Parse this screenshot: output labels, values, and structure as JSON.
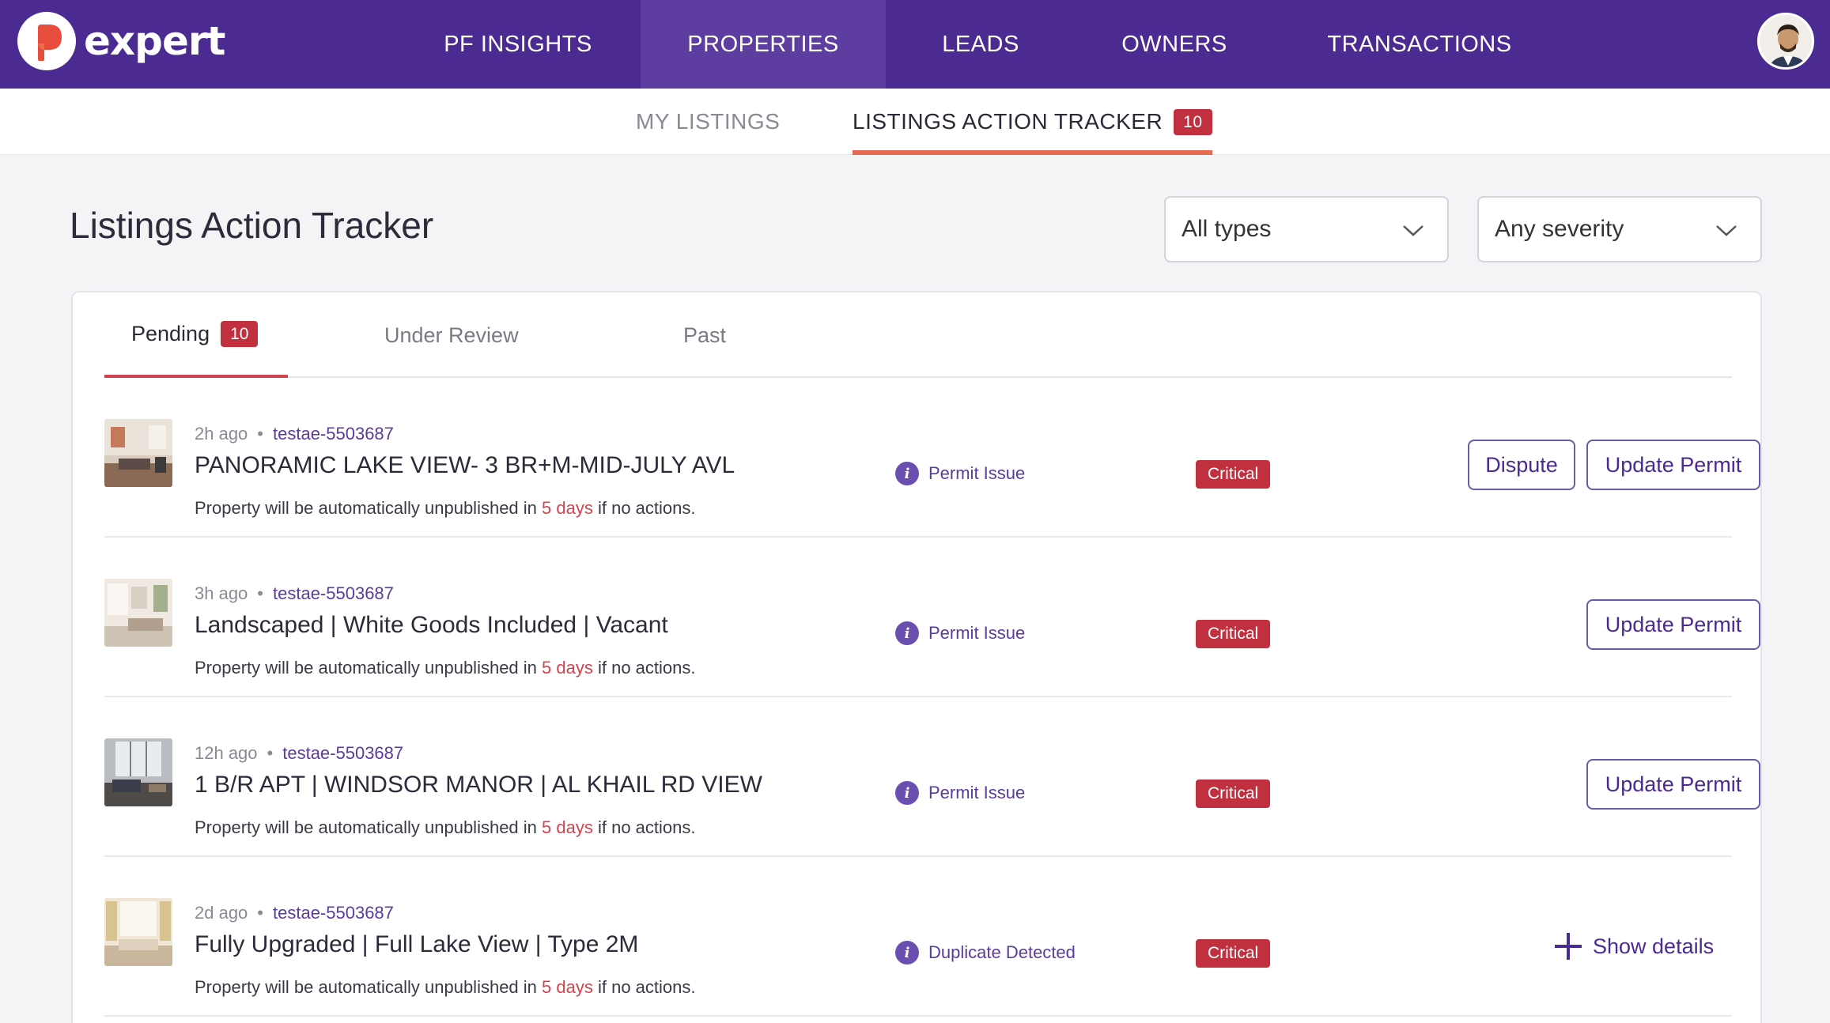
{
  "app": {
    "logo_text": "expert"
  },
  "nav": {
    "items": [
      {
        "label": "PF INSIGHTS",
        "active": false
      },
      {
        "label": "PROPERTIES",
        "active": true
      },
      {
        "label": "LEADS",
        "active": false
      },
      {
        "label": "OWNERS",
        "active": false
      },
      {
        "label": "TRANSACTIONS",
        "active": false
      }
    ]
  },
  "subnav": {
    "my_listings": "MY LISTINGS",
    "tracker": "LISTINGS ACTION TRACKER",
    "tracker_count": "10"
  },
  "page": {
    "title": "Listings Action Tracker"
  },
  "filters": {
    "type": {
      "value": "All types"
    },
    "severity": {
      "value": "Any severity"
    }
  },
  "tabs": {
    "pending": "Pending",
    "pending_count": "10",
    "under_review": "Under Review",
    "past": "Past"
  },
  "listings": [
    {
      "time": "2h ago",
      "ref": "testae-5503687",
      "title": "PANORAMIC LAKE VIEW- 3 BR+M-MID-JULY AVL",
      "note_before": "Property will be automatically unpublished in",
      "days": "5 days",
      "note_after": "if no actions.",
      "issue": "Permit Issue",
      "severity": "Critical",
      "dispute": "Dispute",
      "action": "Update Permit"
    },
    {
      "time": "3h ago",
      "ref": "testae-5503687",
      "title": "Landscaped | White Goods Included | Vacant",
      "note_before": "Property will be automatically unpublished in",
      "days": "5 days",
      "note_after": "if no actions.",
      "issue": "Permit Issue",
      "severity": "Critical",
      "action": "Update Permit"
    },
    {
      "time": "12h ago",
      "ref": "testae-5503687",
      "title": "1 B/R APT | WINDSOR MANOR | AL KHAIL RD VIEW",
      "note_before": "Property will be automatically unpublished in",
      "days": "5 days",
      "note_after": "if no actions.",
      "issue": "Permit Issue",
      "severity": "Critical",
      "action": "Update Permit"
    },
    {
      "time": "2d ago",
      "ref": "testae-5503687",
      "title": "Fully Upgraded | Full Lake View | Type 2M",
      "note_before": "Property will be automatically unpublished in",
      "days": "5 days",
      "note_after": "if no actions.",
      "issue": "Duplicate Detected",
      "severity": "Critical",
      "action": "Show details"
    }
  ],
  "colors": {
    "nav_bg": "#4b2a91",
    "nav_active": "#5d3ea0",
    "accent_red": "#c1303f",
    "link_purple": "#5b3b9d",
    "underline_orange": "#e56a52"
  }
}
